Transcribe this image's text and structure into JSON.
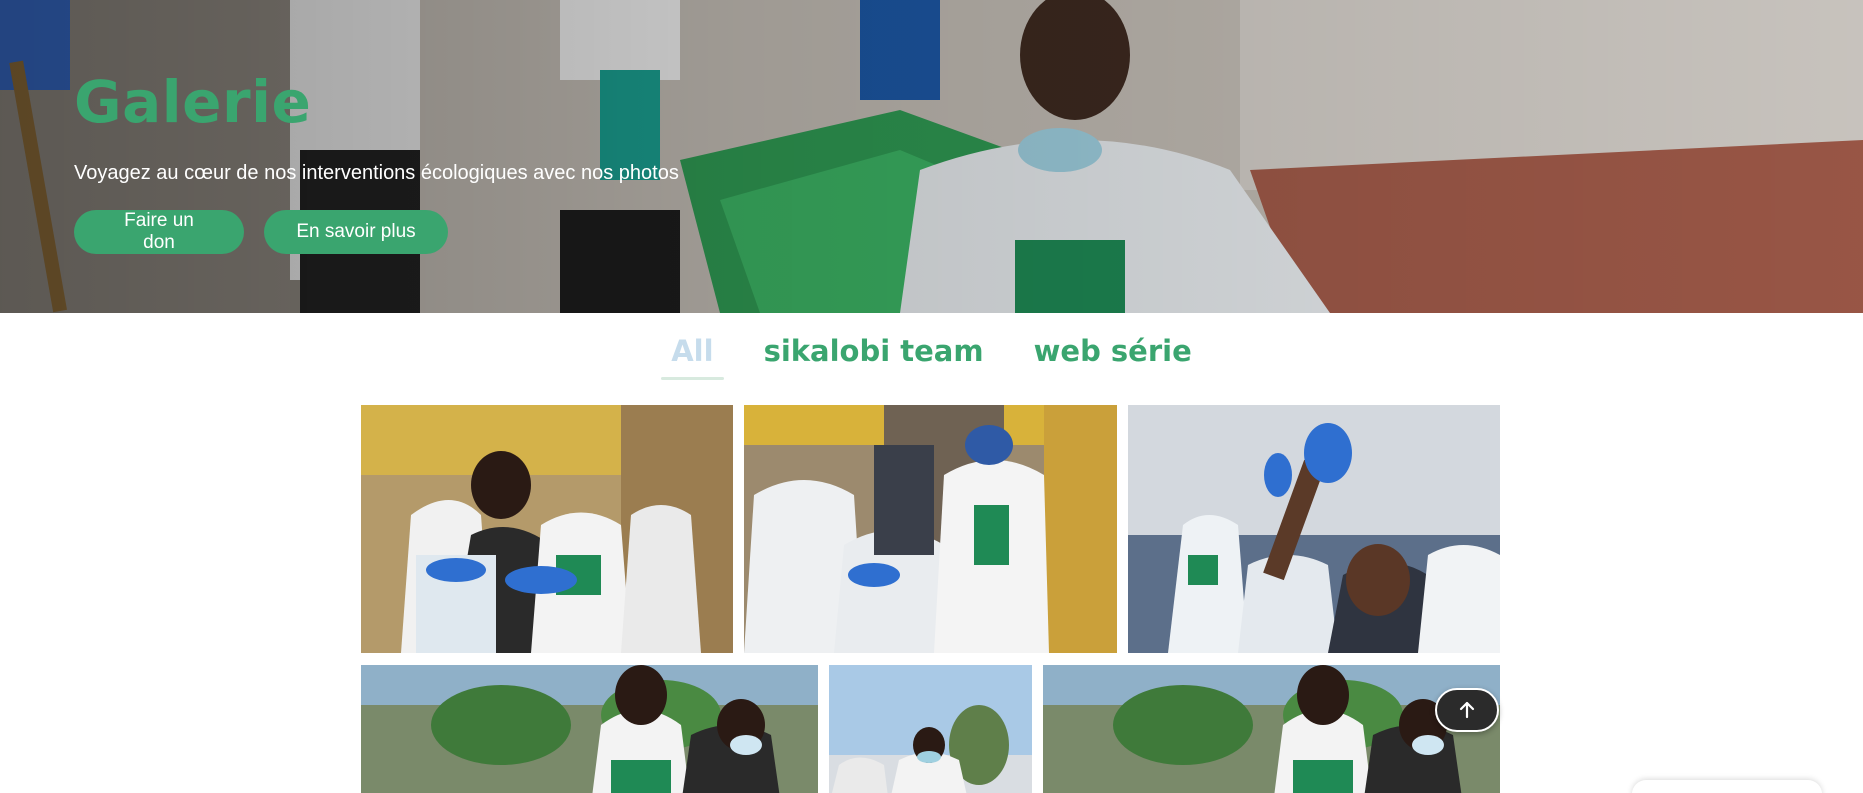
{
  "hero": {
    "title": "Galerie",
    "subtitle": "Voyagez au cœur de nos interventions écologiques avec nos photos",
    "donate_label": "Faire un don",
    "learn_more_label": "En savoir plus"
  },
  "tabs": [
    {
      "label": "All",
      "active": true
    },
    {
      "label": "sikalobi team",
      "active": false
    },
    {
      "label": "web série",
      "active": false
    }
  ],
  "gallery": {
    "items": [
      {
        "subject": "volunteers handing gloves around a plastic bag"
      },
      {
        "subject": "volunteers cleaning in front of a shop"
      },
      {
        "subject": "volunteer raising gloved hand in crowd"
      },
      {
        "subject": "volunteers cleaning street with trees"
      },
      {
        "subject": "volunteer with sky background"
      },
      {
        "subject": "volunteers cleaning street with trees"
      }
    ]
  },
  "colors": {
    "accent": "#3aa56f",
    "tab_inactive_active": "#c6dcec",
    "scroll_button": "#2b2b2b"
  },
  "icons": {
    "scroll_top": "arrow-up-icon"
  }
}
